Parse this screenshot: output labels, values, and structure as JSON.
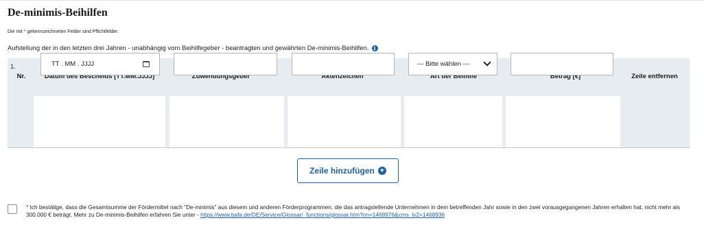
{
  "section": {
    "title": "De-minimis-Beihilfen",
    "required_note_prefix": "Die mit",
    "required_star": "*",
    "required_note_suffix": "gekennzeichneten Felder sind Pflichtfelder.",
    "intro": "Aufstellung der in den letzten drei Jahren - unabhängig vom Beihilfegeber - beantragten und gewährten De-minimis-Beihilfen.",
    "info_glyph": "i"
  },
  "table": {
    "headers": {
      "nr": "Nr.",
      "datum": "Datum des Bescheids [TT.MM.JJJJ]",
      "geber": "Zuwendungsgeber",
      "akten": "Aktenzeichen",
      "art": "Art der Beihilfe",
      "betrag": "Betrag [€]",
      "remove": "Zeile entfernen"
    },
    "rows": [
      {
        "nr": "1.",
        "datum_placeholder": "TT . MM . JJJJ",
        "geber_value": "",
        "akten_value": "",
        "art_selected": "--- Bitte wählen ---",
        "betrag_value": ""
      }
    ]
  },
  "actions": {
    "add_row_label": "Zeile hinzufügen",
    "add_icon_glyph": "+"
  },
  "confirmation": {
    "star": "*",
    "text": "Ich bestätige, dass die Gesamtsumme der Fördermittel nach \"De-minimis\" aus diesem und anderen Förderprogrammen, die das antragstellende Unternehmen in dem betreffenden Jahr sowie in den zwei vorausgegangenen Jahren erhalten hat, nicht mehr als 300.000 € beträgt. Mehr zu De-minimis-Beihilfen erfahren Sie unter -",
    "link": "https://www.bafa.de/DE/Service/Glossar/_functions/glossar.htm?nn=1468976&cms_lv2=1468936",
    "checked": false
  },
  "colors": {
    "accent": "#1f5f9c",
    "required": "#c8102e",
    "table_bg": "#e7ecf0"
  }
}
